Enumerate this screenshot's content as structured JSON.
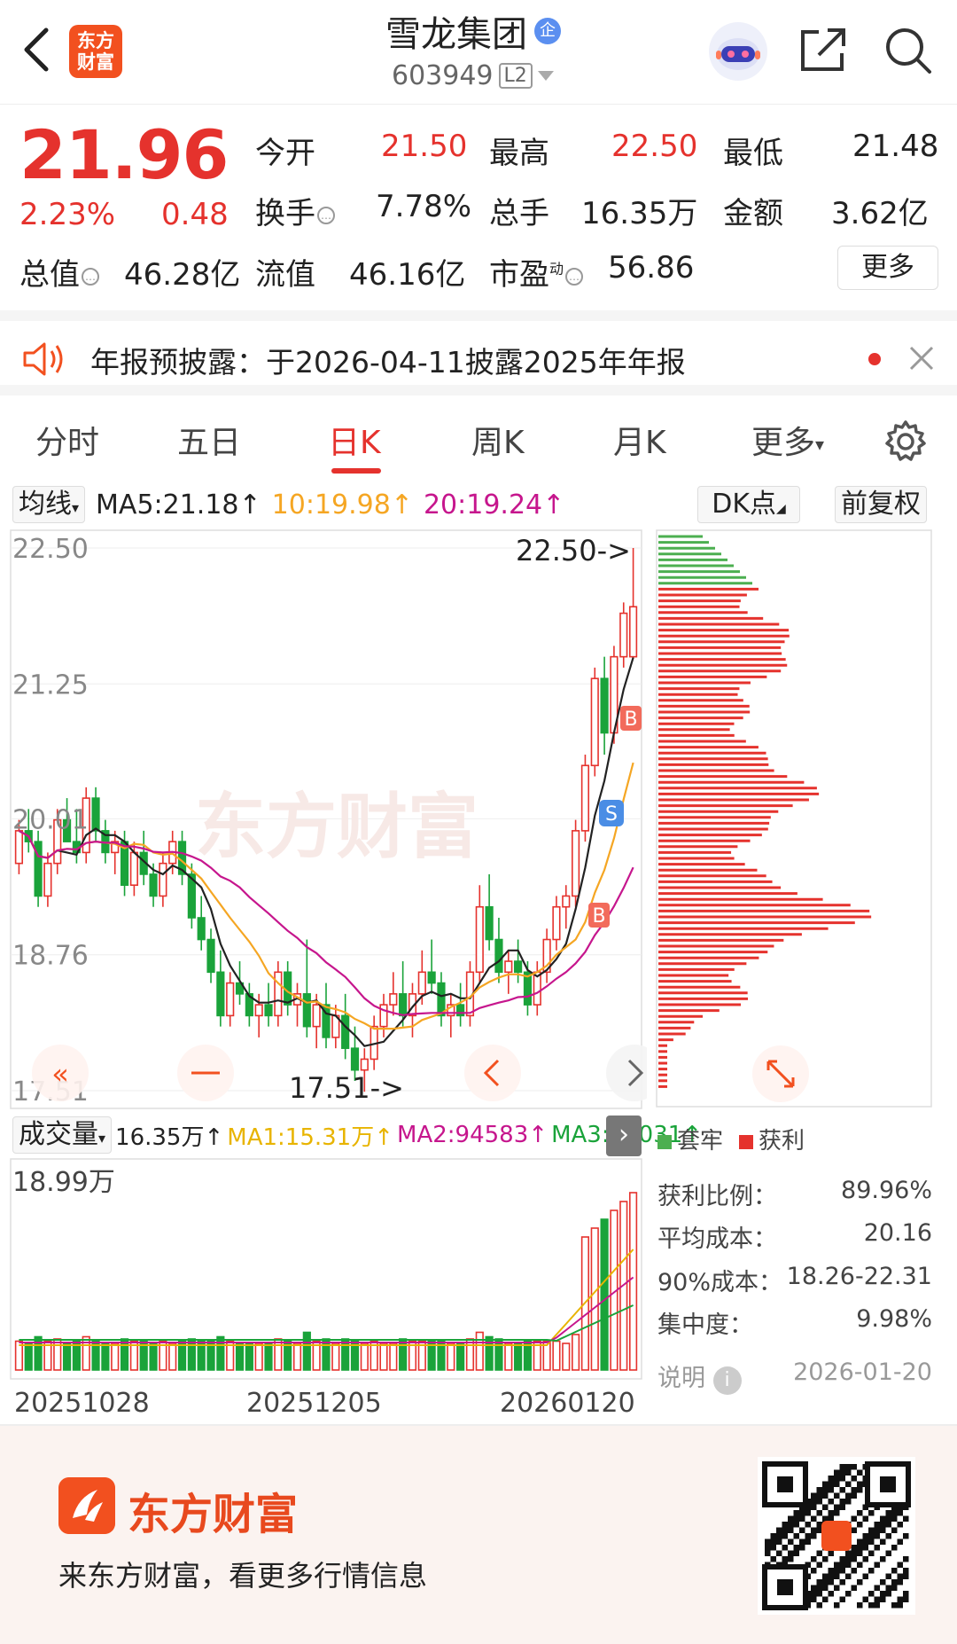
{
  "header": {
    "logo_text_1": "东方",
    "logo_text_2": "财富",
    "title": "雪龙集团",
    "title_badge": "企",
    "code": "603949",
    "level": "L2"
  },
  "quote": {
    "price": "21.96",
    "change_pct": "2.23%",
    "change": "0.48",
    "open_label": "今开",
    "open": "21.50",
    "high_label": "最高",
    "high": "22.50",
    "low_label": "最低",
    "low": "21.48",
    "turnover_label": "换手",
    "turnover": "7.78%",
    "volume_label": "总手",
    "volume": "16.35万",
    "amount_label": "金额",
    "amount": "3.62亿",
    "mktcap_label": "总值",
    "mktcap": "46.28亿",
    "float_label": "流值",
    "float_cap": "46.16亿",
    "pe_label": "市盈",
    "pe_sup": "动",
    "pe": "56.86",
    "more_label": "更多"
  },
  "notice": {
    "text": "年报预披露：于2026-04-11披露2025年年报"
  },
  "tabs": [
    "分时",
    "五日",
    "日K",
    "周K",
    "月K",
    "更多"
  ],
  "active_tab": 2,
  "ma": {
    "selector": "均线",
    "ma5": "MA5:21.18",
    "ma10": "10:19.98",
    "ma20": "20:19.24",
    "dk_label": "DK点",
    "adjust_label": "前复权",
    "colors": {
      "ma5": "#222222",
      "ma10": "#f5a623",
      "ma20": "#c6168d"
    }
  },
  "kline": {
    "y_labels": [
      "22.50",
      "21.25",
      "20.01",
      "18.76",
      "17.51"
    ],
    "high_marker": "22.50->",
    "low_marker": "17.51->",
    "buy_marker": "B",
    "sell_marker": "S"
  },
  "volume": {
    "selector": "成交量",
    "vol": "16.35万",
    "ma1": "MA1:15.31万",
    "ma2": "MA2:94583",
    "ma3": "MA3:66031",
    "max_label": "18.99万"
  },
  "dates": [
    "20251028",
    "20251205",
    "20260120"
  ],
  "chips": {
    "legend_trapped": "套牢",
    "legend_profit": "获利",
    "stats": [
      {
        "label": "获利比例：",
        "value": "89.96%"
      },
      {
        "label": "平均成本：",
        "value": "20.16"
      },
      {
        "label": "90%成本：",
        "value": "18.26-22.31"
      },
      {
        "label": "集中度：",
        "value": "9.98%"
      }
    ],
    "note_label": "说明",
    "date": "2026-01-20"
  },
  "footer": {
    "brand": "东方财富",
    "slogan": "来东方财富，看更多行情信息"
  },
  "chart_data": {
    "type": "candlestick",
    "price_range": [
      17.51,
      22.5
    ],
    "candles": [
      [
        19.6,
        20.0,
        19.5,
        19.9
      ],
      [
        19.9,
        20.1,
        19.7,
        19.8
      ],
      [
        19.8,
        19.9,
        19.2,
        19.3
      ],
      [
        19.3,
        19.7,
        19.2,
        19.6
      ],
      [
        19.6,
        20.1,
        19.5,
        20.0
      ],
      [
        20.0,
        20.2,
        19.8,
        19.8
      ],
      [
        19.8,
        20.1,
        19.6,
        19.7
      ],
      [
        19.7,
        20.3,
        19.6,
        20.2
      ],
      [
        20.2,
        20.3,
        19.8,
        19.9
      ],
      [
        19.9,
        20.0,
        19.6,
        19.7
      ],
      [
        19.7,
        19.9,
        19.5,
        19.8
      ],
      [
        19.8,
        19.9,
        19.3,
        19.4
      ],
      [
        19.4,
        19.8,
        19.3,
        19.7
      ],
      [
        19.7,
        19.9,
        19.4,
        19.5
      ],
      [
        19.5,
        19.6,
        19.2,
        19.3
      ],
      [
        19.3,
        19.7,
        19.2,
        19.6
      ],
      [
        19.6,
        19.9,
        19.5,
        19.8
      ],
      [
        19.8,
        19.9,
        19.4,
        19.5
      ],
      [
        19.5,
        19.6,
        19.0,
        19.1
      ],
      [
        19.1,
        19.3,
        18.8,
        18.9
      ],
      [
        18.9,
        19.0,
        18.5,
        18.6
      ],
      [
        18.6,
        18.8,
        18.1,
        18.2
      ],
      [
        18.2,
        18.6,
        18.1,
        18.5
      ],
      [
        18.5,
        18.7,
        18.3,
        18.4
      ],
      [
        18.4,
        18.5,
        18.1,
        18.2
      ],
      [
        18.2,
        18.4,
        18.0,
        18.3
      ],
      [
        18.3,
        18.5,
        18.1,
        18.2
      ],
      [
        18.2,
        18.7,
        18.1,
        18.6
      ],
      [
        18.6,
        18.7,
        18.2,
        18.3
      ],
      [
        18.3,
        18.5,
        18.1,
        18.4
      ],
      [
        18.4,
        18.9,
        18.0,
        18.1
      ],
      [
        18.1,
        18.4,
        17.9,
        18.3
      ],
      [
        18.3,
        18.5,
        17.9,
        18.0
      ],
      [
        18.0,
        18.3,
        17.9,
        18.2
      ],
      [
        18.2,
        18.4,
        17.8,
        17.9
      ],
      [
        17.9,
        18.1,
        17.6,
        17.7
      ],
      [
        17.7,
        17.9,
        17.5,
        17.8
      ],
      [
        17.8,
        18.2,
        17.7,
        18.1
      ],
      [
        18.1,
        18.4,
        18.0,
        18.3
      ],
      [
        18.3,
        18.6,
        18.2,
        18.4
      ],
      [
        18.4,
        18.7,
        18.1,
        18.2
      ],
      [
        18.2,
        18.5,
        18.0,
        18.4
      ],
      [
        18.4,
        18.8,
        18.3,
        18.6
      ],
      [
        18.6,
        18.9,
        18.4,
        18.5
      ],
      [
        18.5,
        18.6,
        18.1,
        18.2
      ],
      [
        18.2,
        18.4,
        18.0,
        18.3
      ],
      [
        18.3,
        18.5,
        18.1,
        18.2
      ],
      [
        18.2,
        18.7,
        18.1,
        18.6
      ],
      [
        18.6,
        19.4,
        18.5,
        19.2
      ],
      [
        19.2,
        19.5,
        18.8,
        18.9
      ],
      [
        18.9,
        19.1,
        18.5,
        18.6
      ],
      [
        18.6,
        18.8,
        18.4,
        18.7
      ],
      [
        18.7,
        18.9,
        18.5,
        18.6
      ],
      [
        18.6,
        18.7,
        18.2,
        18.3
      ],
      [
        18.3,
        18.7,
        18.2,
        18.6
      ],
      [
        18.6,
        19.0,
        18.5,
        18.9
      ],
      [
        18.9,
        19.3,
        18.8,
        19.2
      ],
      [
        19.2,
        19.4,
        19.0,
        19.3
      ],
      [
        19.3,
        20.0,
        19.2,
        19.9
      ],
      [
        19.9,
        20.6,
        19.8,
        20.5
      ],
      [
        20.5,
        21.4,
        20.4,
        21.3
      ],
      [
        21.3,
        21.5,
        20.6,
        20.8
      ],
      [
        20.8,
        21.6,
        20.7,
        21.5
      ],
      [
        21.5,
        22.0,
        21.4,
        21.9
      ],
      [
        21.5,
        22.5,
        21.48,
        21.96
      ]
    ]
  }
}
